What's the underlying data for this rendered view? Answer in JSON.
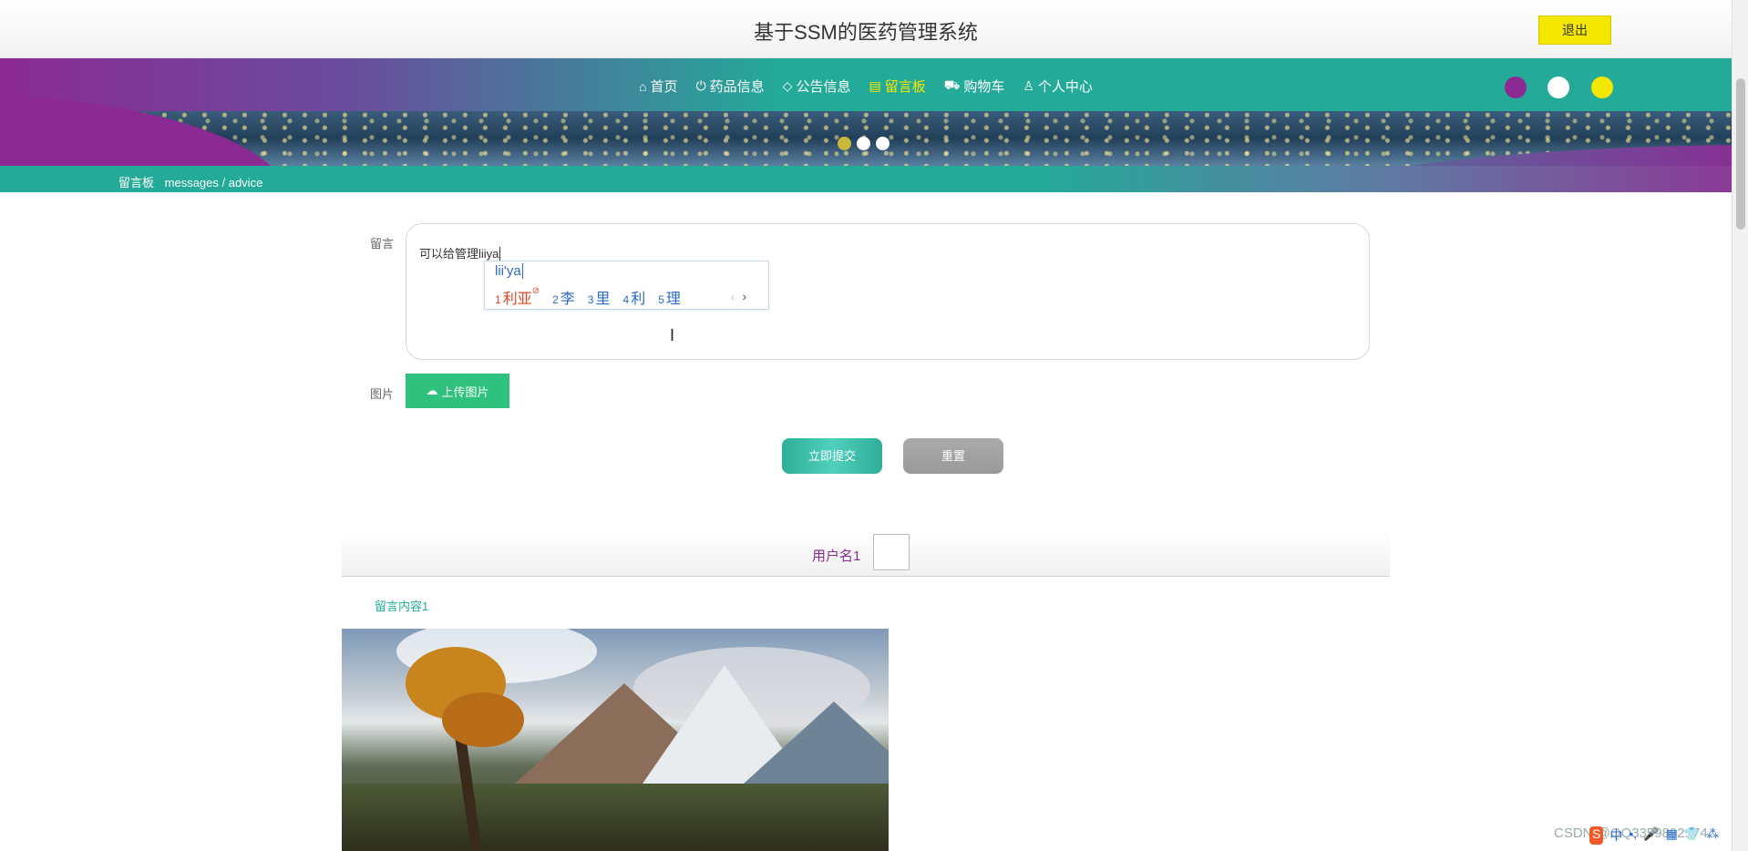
{
  "header": {
    "site_title": "基于SSM的医药管理系统",
    "logout_label": "退出"
  },
  "nav": {
    "items": [
      {
        "label": "首页",
        "icon": "home-icon"
      },
      {
        "label": "药品信息",
        "icon": "power-icon"
      },
      {
        "label": "公告信息",
        "icon": "tag-icon"
      },
      {
        "label": "留言板",
        "icon": "document-icon",
        "active": true
      },
      {
        "label": "购物车",
        "icon": "cart-icon"
      },
      {
        "label": "个人中心",
        "icon": "user-icon"
      }
    ],
    "theme_dots": [
      "#8b2a93",
      "#ffffff",
      "#f5e800"
    ]
  },
  "breadcrumb": {
    "title": "留言板",
    "path": "messages / advice"
  },
  "form": {
    "message_label": "留言",
    "message_value": "可以给管理liiya",
    "image_label": "图片",
    "upload_label": "上传图片",
    "submit_label": "立即提交",
    "reset_label": "重置"
  },
  "ime": {
    "pinyin": "lii'ya",
    "candidates": [
      {
        "n": "1",
        "text": "利亚"
      },
      {
        "n": "2",
        "text": "李"
      },
      {
        "n": "3",
        "text": "里"
      },
      {
        "n": "4",
        "text": "利"
      },
      {
        "n": "5",
        "text": "理"
      }
    ],
    "prev": "‹",
    "next": "›"
  },
  "messages": [
    {
      "username": "用户名1",
      "content": "留言内容1"
    }
  ],
  "watermark": "CSDN @QQ3359892174",
  "tray": {
    "logo": "S",
    "lang": "中",
    "items": [
      "•,",
      "🎤",
      "▦",
      "👕",
      "⁂"
    ]
  }
}
